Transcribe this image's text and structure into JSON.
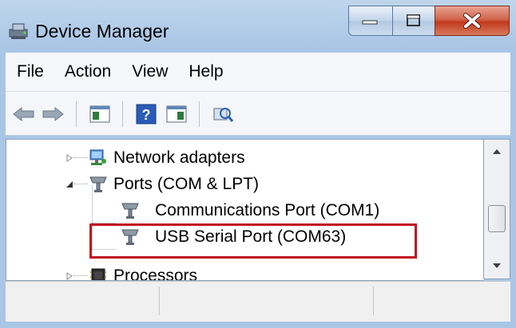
{
  "window": {
    "title": "Device Manager"
  },
  "menu": {
    "items": [
      "File",
      "Action",
      "View",
      "Help"
    ]
  },
  "toolbar": {
    "buttons": [
      "back-arrow-icon",
      "forward-arrow-icon",
      "show-hide-console-tree-icon",
      "help-icon",
      "action-pane-icon",
      "scan-hardware-icon"
    ]
  },
  "tree": {
    "items": [
      {
        "label": "Network adapters",
        "expanded": false,
        "icon": "network-adapter-icon"
      },
      {
        "label": "Ports (COM & LPT)",
        "expanded": true,
        "icon": "port-icon"
      },
      {
        "label": "Communications Port (COM1)",
        "icon": "port-icon"
      },
      {
        "label": "USB Serial Port (COM63)",
        "icon": "port-icon",
        "highlighted": true
      },
      {
        "label": "Processors",
        "expanded": false,
        "icon": "processor-icon"
      }
    ]
  },
  "colors": {
    "highlight_border": "#c0141f",
    "close_button": "#c2391c"
  }
}
